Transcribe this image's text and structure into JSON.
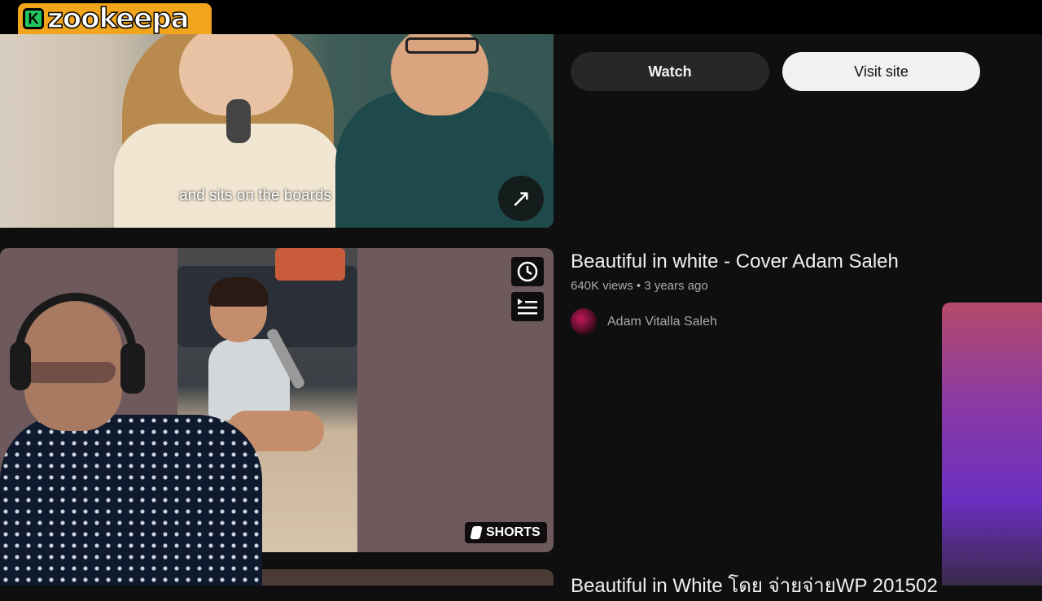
{
  "logo": {
    "badge_letter": "K",
    "text": "zookeepa"
  },
  "video1": {
    "caption": "and sits on the boards",
    "open_icon": "arrow-up-right-icon",
    "watch_label": "Watch",
    "visit_label": "Visit site"
  },
  "video2": {
    "title": "Beautiful in white - Cover Adam Saleh",
    "views": "640K views",
    "separator": "•",
    "age": "3 years ago",
    "channel": "Adam Vitalla Saleh",
    "badge": "SHORTS",
    "watch_later_icon": "clock-icon",
    "queue_icon": "add-to-queue-icon"
  },
  "video3": {
    "title": "Beautiful in White โดย จ่ายจ่ายWP 201502"
  },
  "colors": {
    "background": "#0f0f0f",
    "topbar": "#000000",
    "logo_bg": "#f0a51c",
    "logo_badge": "#22c55e",
    "watch_button": "#272727",
    "visit_button": "#f1f1f1",
    "meta_text": "#aaaaaa"
  }
}
